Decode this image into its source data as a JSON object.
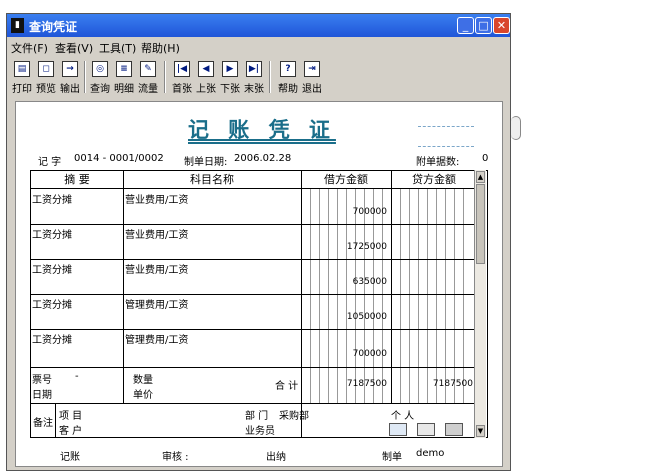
{
  "window": {
    "title": "查询凭证"
  },
  "menu": [
    "文件(F)",
    "查看(V)",
    "工具(T)",
    "帮助(H)"
  ],
  "toolbar": {
    "print": "打印",
    "preview": "预览",
    "output": "输出",
    "query": "查询",
    "detail": "明细",
    "flow": "流量",
    "first": "首张",
    "prev": "上张",
    "next": "下张",
    "last": "末张",
    "help": "帮助",
    "exit": "退出"
  },
  "voucher": {
    "title": "记 账 凭 证",
    "type_label": "记 字",
    "number": "0014 - 0001/0002",
    "date_label": "制单日期:",
    "date": "2006.02.28",
    "attach_label": "附单据数:",
    "attach_count": "0",
    "headers": {
      "summary": "摘 要",
      "account": "科目名称",
      "debit": "借方金额",
      "credit": "贷方金额"
    },
    "rows": [
      {
        "summary": "工资分摊",
        "account": "营业费用/工资",
        "debit": "700000"
      },
      {
        "summary": "工资分摊",
        "account": "营业费用/工资",
        "debit": "1725000"
      },
      {
        "summary": "工资分摊",
        "account": "营业费用/工资",
        "debit": "635000"
      },
      {
        "summary": "工资分摊",
        "account": "管理费用/工资",
        "debit": "1050000"
      },
      {
        "summary": "工资分摊",
        "account": "管理费用/工资",
        "debit": "700000"
      }
    ],
    "ticket_label": "票号",
    "ticket_value": "-",
    "date2_label": "日期",
    "qty_label": "数量",
    "price_label": "单价",
    "total_label": "合 计",
    "total_debit": "7187500",
    "total_credit": "7187500",
    "remark_label": "备注",
    "project_label": "项 目",
    "customer_label": "客 户",
    "dept_label": "部 门",
    "dept_value": "采购部",
    "person_label": "个 人",
    "staff_label": "业务员"
  },
  "footer": {
    "bookkeeping": "记账",
    "audit": "审核 :",
    "cashier": "出纳",
    "maker_label": "制单",
    "maker": "demo"
  }
}
